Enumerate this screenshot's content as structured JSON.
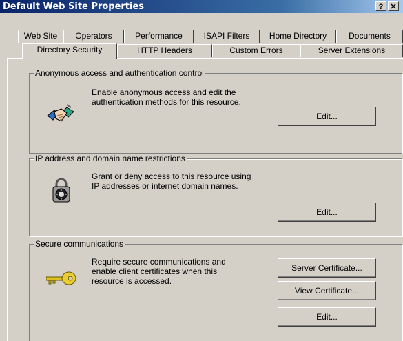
{
  "window": {
    "title": "Default Web Site Properties"
  },
  "title_buttons": {
    "help": "?",
    "close": "✕"
  },
  "tabs": {
    "back_row": [
      "Web Site",
      "Operators",
      "Performance",
      "ISAPI Filters",
      "Home Directory",
      "Documents"
    ],
    "front_row": [
      "Directory Security",
      "HTTP Headers",
      "Custom Errors",
      "Server Extensions"
    ],
    "active": "Directory Security"
  },
  "anonymous": {
    "label": "Anonymous access and authentication control",
    "description": "Enable anonymous access and edit the\nauthentication methods for this resource.",
    "edit_label": "Edit...",
    "icon": "handshake-icon"
  },
  "ip": {
    "label": "IP address and domain name restrictions",
    "description": "Grant or deny access to this resource using\nIP addresses or internet domain names.",
    "edit_label": "Edit...",
    "icon": "padlock-icon"
  },
  "secure": {
    "label": "Secure communications",
    "description": "Require secure communications and\nenable client certificates when this\nresource is accessed.",
    "server_cert_label": "Server Certificate...",
    "view_cert_label": "View Certificate...",
    "edit_label": "Edit...",
    "icon": "key-icon"
  },
  "colors": {
    "title_bar": "#0a246a",
    "face": "#d4d0c8"
  }
}
